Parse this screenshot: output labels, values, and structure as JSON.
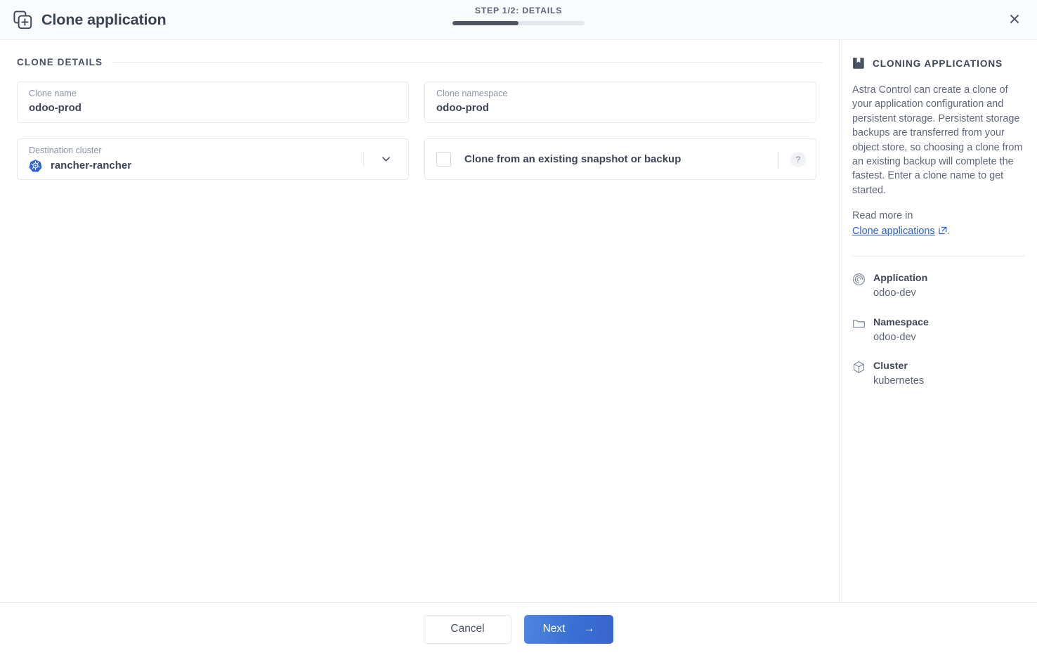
{
  "header": {
    "title": "Clone application",
    "title_icon": "clone-plus-icon",
    "step_label": "STEP 1/2: DETAILS",
    "progress_percent": 50,
    "close_icon": "close-icon"
  },
  "main": {
    "section_title": "CLONE DETAILS",
    "fields": {
      "clone_name": {
        "label": "Clone name",
        "value": "odoo-prod",
        "placeholder": "Clone name"
      },
      "clone_namespace": {
        "label": "Clone namespace",
        "value": "odoo-prod",
        "placeholder": "Clone namespace"
      },
      "destination_cluster": {
        "label": "Destination cluster",
        "value": "rancher-rancher",
        "icon": "kubernetes-icon",
        "caret_icon": "chevron-down-icon"
      },
      "clone_from_snapshot": {
        "label": "Clone from an existing snapshot or backup",
        "checked": false,
        "help_icon": "question-mark-icon"
      }
    }
  },
  "sidebar": {
    "icon": "book-icon",
    "title": "CLONING APPLICATIONS",
    "paragraph": "Astra Control can create a clone of your application configuration and persistent storage. Persistent storage backups are transferred from your object store, so choosing a clone from an existing backup will complete the fastest. Enter a clone name to get started.",
    "read_more_prefix": "Read more in",
    "link_text": "Clone applications",
    "link_icon": "external-link-icon",
    "link_suffix": ".",
    "meta": [
      {
        "icon": "application-swirl-icon",
        "key": "Application",
        "value": "odoo-dev"
      },
      {
        "icon": "folder-icon",
        "key": "Namespace",
        "value": "odoo-dev"
      },
      {
        "icon": "cube-icon",
        "key": "Cluster",
        "value": "kubernetes"
      }
    ]
  },
  "footer": {
    "cancel_label": "Cancel",
    "next_label": "Next",
    "next_arrow": "→"
  },
  "colors": {
    "accent": "#3a6fd4",
    "link": "#2b5fc7",
    "text": "#3c4455",
    "muted": "#8b93a3",
    "border": "#e4e9ef",
    "progress_fill": "#4f5562",
    "kubernetes_blue": "#3261d6"
  }
}
